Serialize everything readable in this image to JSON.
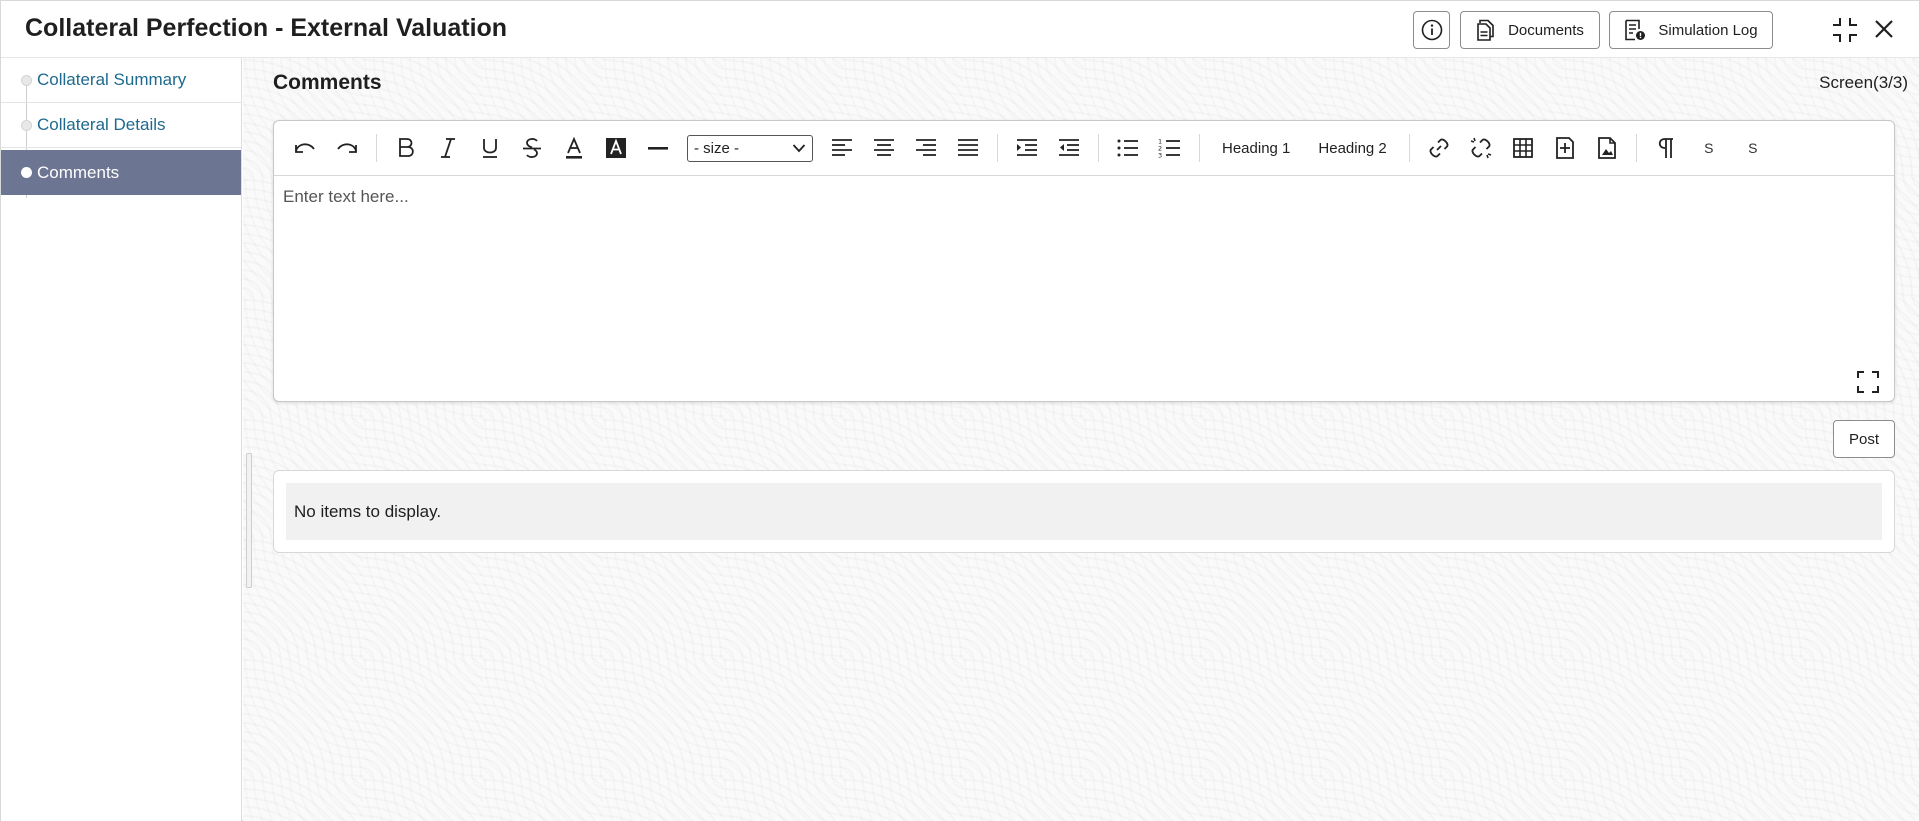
{
  "header": {
    "title": "Collateral Perfection - External Valuation",
    "documents_label": "Documents",
    "simulation_log_label": "Simulation Log"
  },
  "sidebar": {
    "items": [
      {
        "label": "Collateral Summary",
        "active": false
      },
      {
        "label": "Collateral Details",
        "active": false
      },
      {
        "label": "Comments",
        "active": true
      }
    ]
  },
  "main": {
    "section_title": "Comments",
    "screen_counter": "Screen(3/3)"
  },
  "editor": {
    "size_select": "- size -",
    "heading1": "Heading 1",
    "heading2": "Heading 2",
    "sub_label": "S",
    "sup_label": "S",
    "placeholder": "Enter text here..."
  },
  "post": {
    "label": "Post"
  },
  "comments": {
    "empty_message": "No items to display."
  },
  "colors": {
    "active_nav_bg": "#6c7692",
    "link_color": "#1e6a8e"
  }
}
